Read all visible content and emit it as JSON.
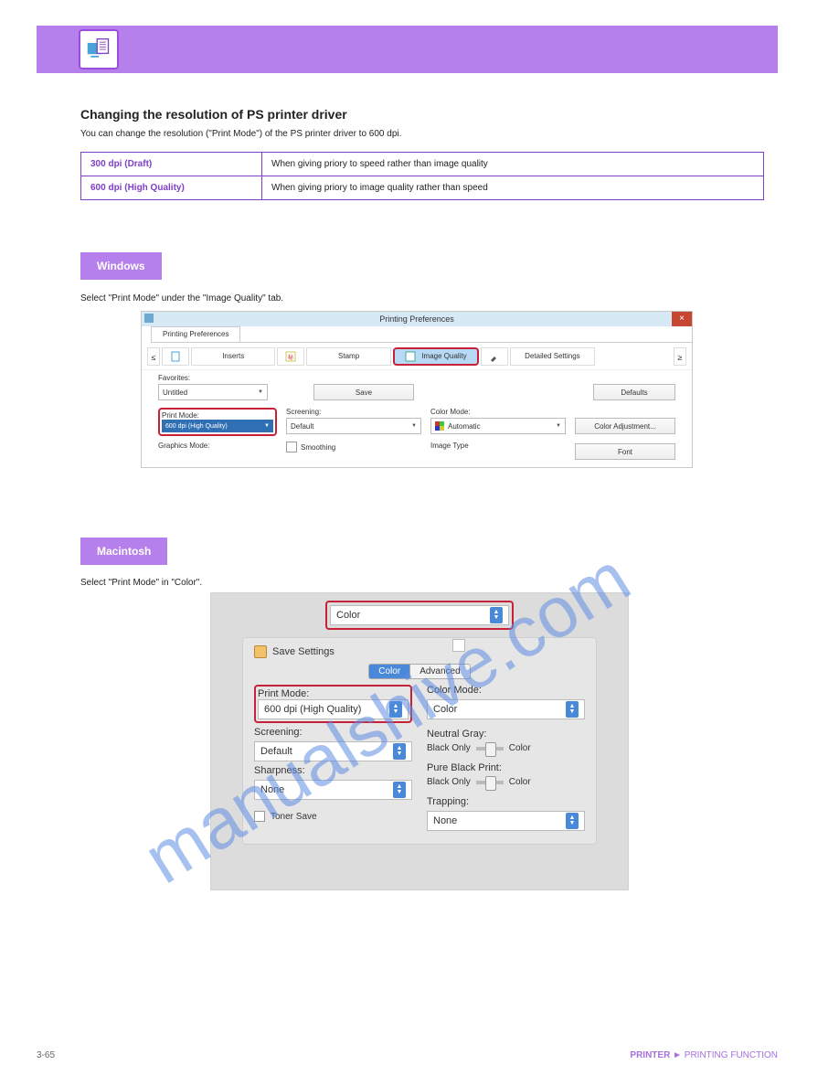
{
  "section_title": "Changing the resolution of PS printer driver",
  "intro": "You can change the resolution (\"Print Mode\") of the PS printer driver to 600 dpi.",
  "table": {
    "rows": [
      {
        "label": "300 dpi (Draft)",
        "desc": "When giving priory to speed rather than image quality"
      },
      {
        "label": "600 dpi (High Quality)",
        "desc": "When giving priory to image quality rather than speed"
      }
    ]
  },
  "badge_windows": "Windows",
  "caption_windows": "Select \"Print Mode\" under the \"Image Quality\" tab.",
  "badge_mac": "Macintosh",
  "caption_mac": "Select \"Print Mode\" in \"Color\".",
  "win": {
    "title": "Printing Preferences",
    "tab": "Printing Preferences",
    "toolbar": {
      "leftArrow": "≤",
      "inserts": "Inserts",
      "stamp": "Stamp",
      "imageQuality": "Image Quality",
      "detailed": "Detailed Settings",
      "rightArrow": "≥"
    },
    "favorites_label": "Favorites:",
    "favorites_value": "Untitled",
    "save": "Save",
    "defaults": "Defaults",
    "printmode_label": "Print Mode:",
    "printmode_value": "600 dpi (High Quality)",
    "screening_label": "Screening:",
    "screening_value": "Default",
    "colormode_label": "Color Mode:",
    "colormode_value": "Automatic",
    "coloradj": "Color Adjustment...",
    "graphics_label": "Graphics Mode:",
    "smoothing_label": "Smoothing",
    "imagetype_label": "Image Type",
    "font": "Font"
  },
  "mac": {
    "top_select": "Color",
    "save_settings": "Save Settings",
    "seg_color": "Color",
    "seg_advanced": "Advanced",
    "printmode_label": "Print Mode:",
    "printmode_value": "600 dpi (High Quality)",
    "screening_label": "Screening:",
    "screening_value": "Default",
    "sharpness_label": "Sharpness:",
    "sharpness_value": "None",
    "tonersave": "Toner Save",
    "colormode_label": "Color Mode:",
    "colormode_value": "Color",
    "neutral_label": "Neutral Gray:",
    "black_only": "Black Only",
    "color": "Color",
    "pureblack_label": "Pure Black Print:",
    "trapping_label": "Trapping:",
    "trapping_value": "None"
  },
  "watermark": "manualshive.com",
  "footer": {
    "left": "3-65",
    "right_a": "PRINTER",
    "right_b": "PRINTING FUNCTION"
  }
}
